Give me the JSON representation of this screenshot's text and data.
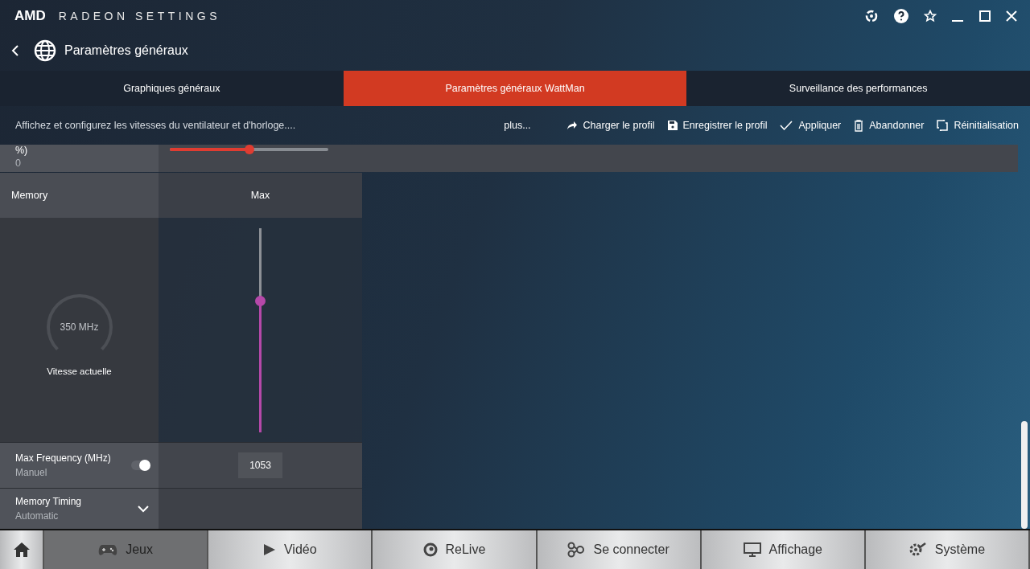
{
  "window": {
    "brand": "AMD",
    "title": "RADEON SETTINGS"
  },
  "header": {
    "title": "Paramètres généraux"
  },
  "tabs": [
    {
      "label": "Graphiques généraux",
      "selected": false
    },
    {
      "label": "Paramètres généraux WattMan",
      "selected": true
    },
    {
      "label": "Surveillance des performances",
      "selected": false
    }
  ],
  "toolbar": {
    "description": "Affichez et configurez les vitesses du ventilateur et d'horloge....",
    "more": "plus...",
    "actions": [
      "Charger le profil",
      "Enregistrer le profil",
      "Appliquer",
      "Abandonner",
      "Réinitialisation"
    ]
  },
  "power_row": {
    "label": "%)",
    "value": "0",
    "level": 0.5
  },
  "memory": {
    "title": "Memory",
    "column": "Max",
    "gauge_value": "350 MHz",
    "gauge_label": "Vitesse actuelle",
    "vertical_slider": {
      "level": 0.64
    },
    "max_frequency": {
      "label": "Max Frequency (MHz)",
      "mode": "Manuel",
      "on": true,
      "value": "1053"
    },
    "timing": {
      "label": "Memory Timing",
      "mode": "Automatic",
      "expanded": false
    }
  },
  "bottom_nav": [
    {
      "label": "Jeux",
      "selected": true
    },
    {
      "label": "Vidéo",
      "selected": false
    },
    {
      "label": "ReLive",
      "selected": false
    },
    {
      "label": "Se connecter",
      "selected": false
    },
    {
      "label": "Affichage",
      "selected": false
    },
    {
      "label": "Système",
      "selected": false
    }
  ]
}
